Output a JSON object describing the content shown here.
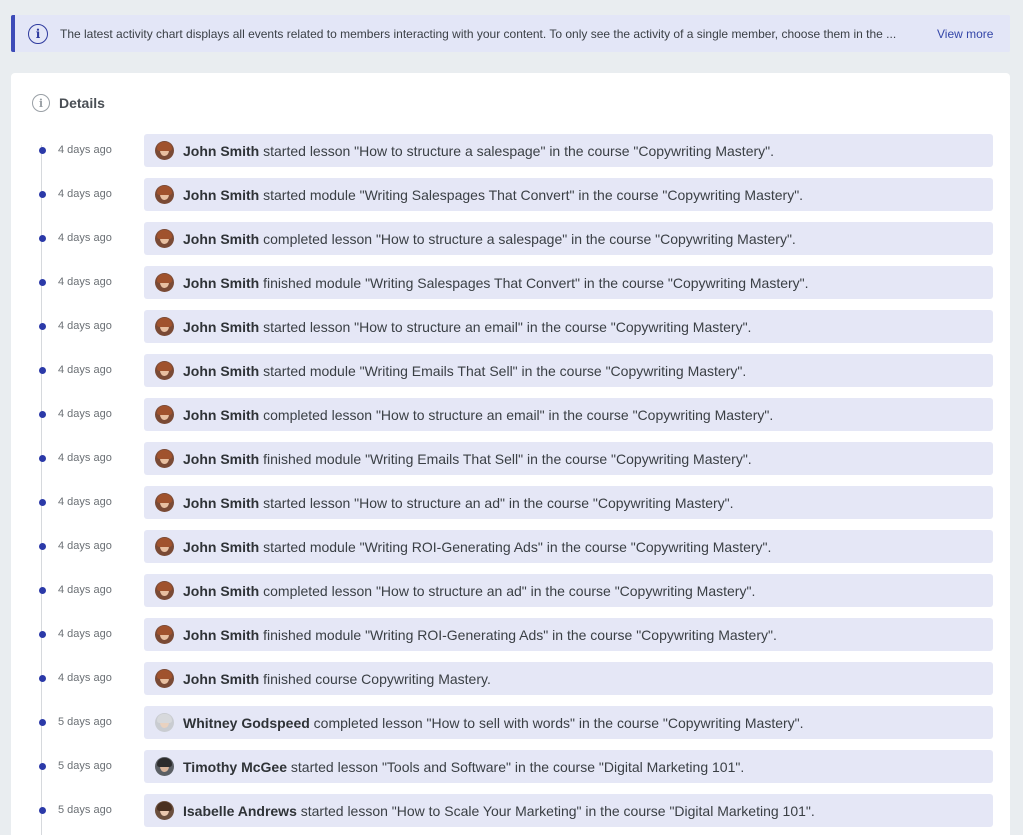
{
  "banner": {
    "icon": "info-icon",
    "text": "The latest activity chart displays all events related to members interacting with your content. To only see the activity of a single member, choose them in the ...",
    "link_label": "View more"
  },
  "details": {
    "icon": "info-icon",
    "title": "Details"
  },
  "colors": {
    "accent": "#2b39a8",
    "bubble": "#e5e7f6",
    "banner": "#e3e6f7"
  },
  "activities": [
    {
      "time": "4 days ago",
      "member": "John Smith",
      "text": " started lesson \"How to structure a salespage\" in the course \"Copywriting Mastery\".",
      "avatar": "john"
    },
    {
      "time": "4 days ago",
      "member": "John Smith",
      "text": " started module \"Writing Salespages That Convert\" in the course \"Copywriting Mastery\".",
      "avatar": "john"
    },
    {
      "time": "4 days ago",
      "member": "John Smith",
      "text": " completed lesson \"How to structure a salespage\" in the course \"Copywriting Mastery\".",
      "avatar": "john"
    },
    {
      "time": "4 days ago",
      "member": "John Smith",
      "text": " finished module \"Writing Salespages That Convert\" in the course \"Copywriting Mastery\".",
      "avatar": "john"
    },
    {
      "time": "4 days ago",
      "member": "John Smith",
      "text": " started lesson \"How to structure an email\" in the course \"Copywriting Mastery\".",
      "avatar": "john"
    },
    {
      "time": "4 days ago",
      "member": "John Smith",
      "text": " started module \"Writing Emails That Sell\" in the course \"Copywriting Mastery\".",
      "avatar": "john"
    },
    {
      "time": "4 days ago",
      "member": "John Smith",
      "text": " completed lesson \"How to structure an email\" in the course \"Copywriting Mastery\".",
      "avatar": "john"
    },
    {
      "time": "4 days ago",
      "member": "John Smith",
      "text": " finished module \"Writing Emails That Sell\" in the course \"Copywriting Mastery\".",
      "avatar": "john"
    },
    {
      "time": "4 days ago",
      "member": "John Smith",
      "text": " started lesson \"How to structure an ad\" in the course \"Copywriting Mastery\".",
      "avatar": "john"
    },
    {
      "time": "4 days ago",
      "member": "John Smith",
      "text": " started module \"Writing ROI-Generating Ads\" in the course \"Copywriting Mastery\".",
      "avatar": "john"
    },
    {
      "time": "4 days ago",
      "member": "John Smith",
      "text": " completed lesson \"How to structure an ad\" in the course \"Copywriting Mastery\".",
      "avatar": "john"
    },
    {
      "time": "4 days ago",
      "member": "John Smith",
      "text": " finished module \"Writing ROI-Generating Ads\" in the course \"Copywriting Mastery\".",
      "avatar": "john"
    },
    {
      "time": "4 days ago",
      "member": "John Smith",
      "text": " finished course Copywriting Mastery.",
      "avatar": "john"
    },
    {
      "time": "5 days ago",
      "member": "Whitney Godspeed",
      "text": " completed lesson \"How to sell with words\" in the course \"Copywriting Mastery\".",
      "avatar": "whitney"
    },
    {
      "time": "5 days ago",
      "member": "Timothy McGee",
      "text": " started lesson \"Tools and Software\" in the course \"Digital Marketing 101\".",
      "avatar": "timothy"
    },
    {
      "time": "5 days ago",
      "member": "Isabelle Andrews",
      "text": " started lesson \"How to Scale Your Marketing\" in the course \"Digital Marketing 101\".",
      "avatar": "isabelle"
    }
  ]
}
